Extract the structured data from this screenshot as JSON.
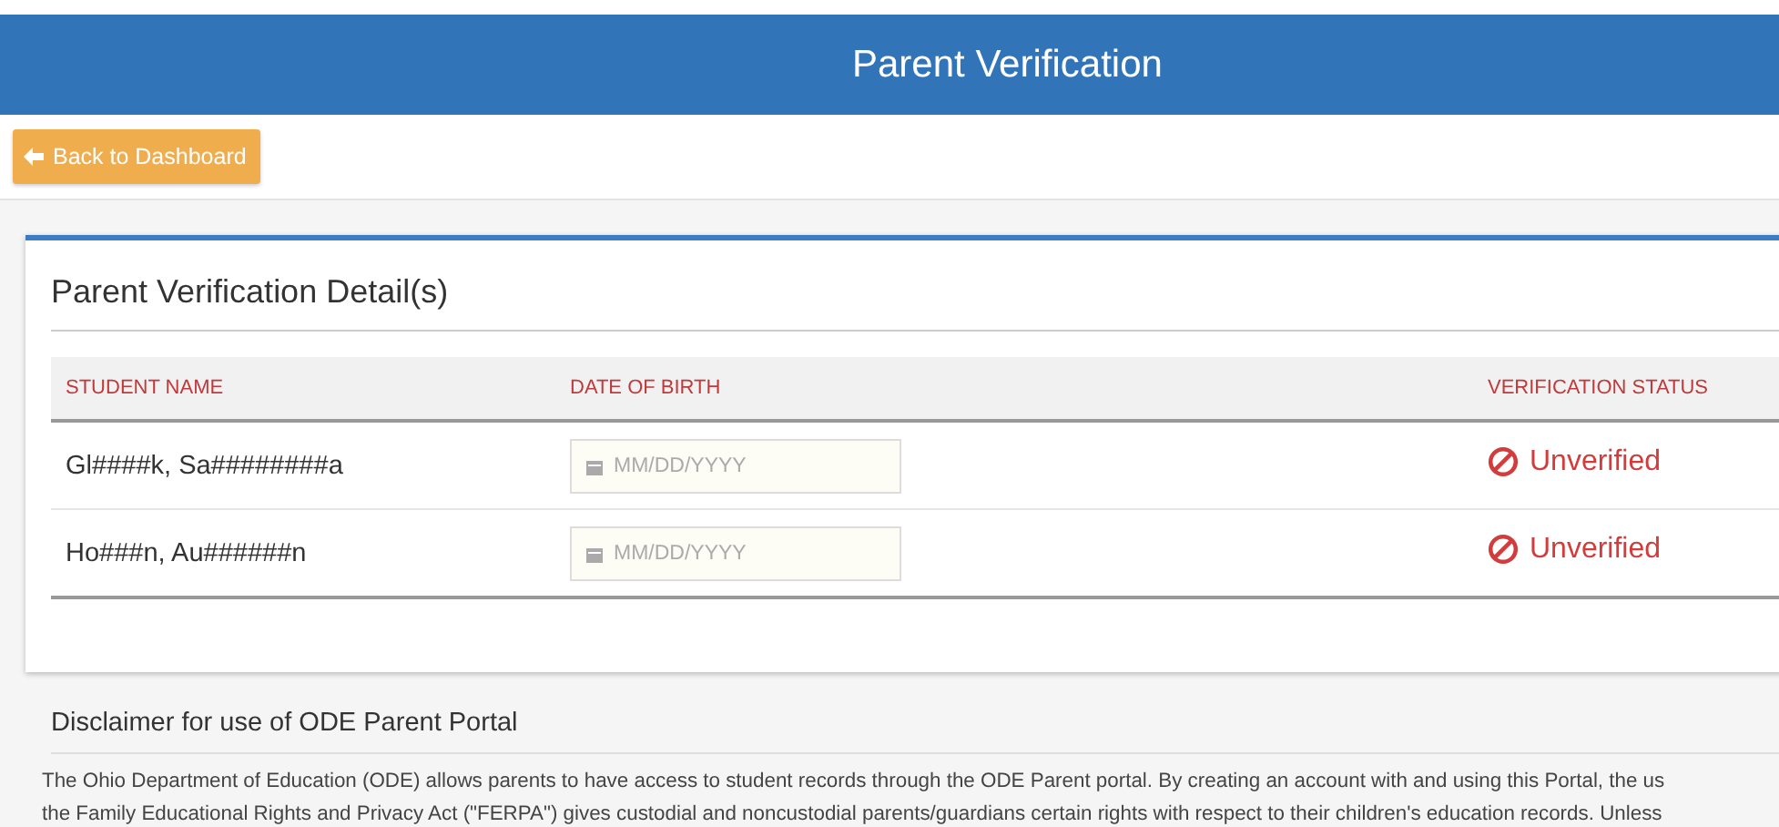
{
  "header": {
    "title": "Parent Verification"
  },
  "back_button": {
    "label": "Back to Dashboard"
  },
  "card": {
    "title": "Parent Verification Detail(s)",
    "table": {
      "columns": [
        "STUDENT NAME",
        "DATE OF BIRTH",
        "VERIFICATION STATUS"
      ],
      "rows": [
        {
          "student_name": "Gl####k, Sa########a",
          "date_of_birth": {
            "placeholder": "MM/DD/YYYY"
          },
          "status": "Unverified",
          "verified": false
        },
        {
          "student_name": "Ho###n, Au######n",
          "date_of_birth": {
            "placeholder": "MM/DD/YYYY"
          },
          "status": "Unverified",
          "verified": false
        }
      ]
    }
  },
  "disclaimer": {
    "title": "Disclaimer for use of ODE Parent Portal",
    "lines": [
      "The Ohio Department of Education (ODE) allows parents to have access to student records through the ODE Parent portal. By creating an account with and using this Portal, the us",
      "the Family Educational Rights and Privacy Act (\"FERPA\") gives custodial and noncustodial parents/guardians certain rights with respect to their children's education records. Unless"
    ]
  }
}
